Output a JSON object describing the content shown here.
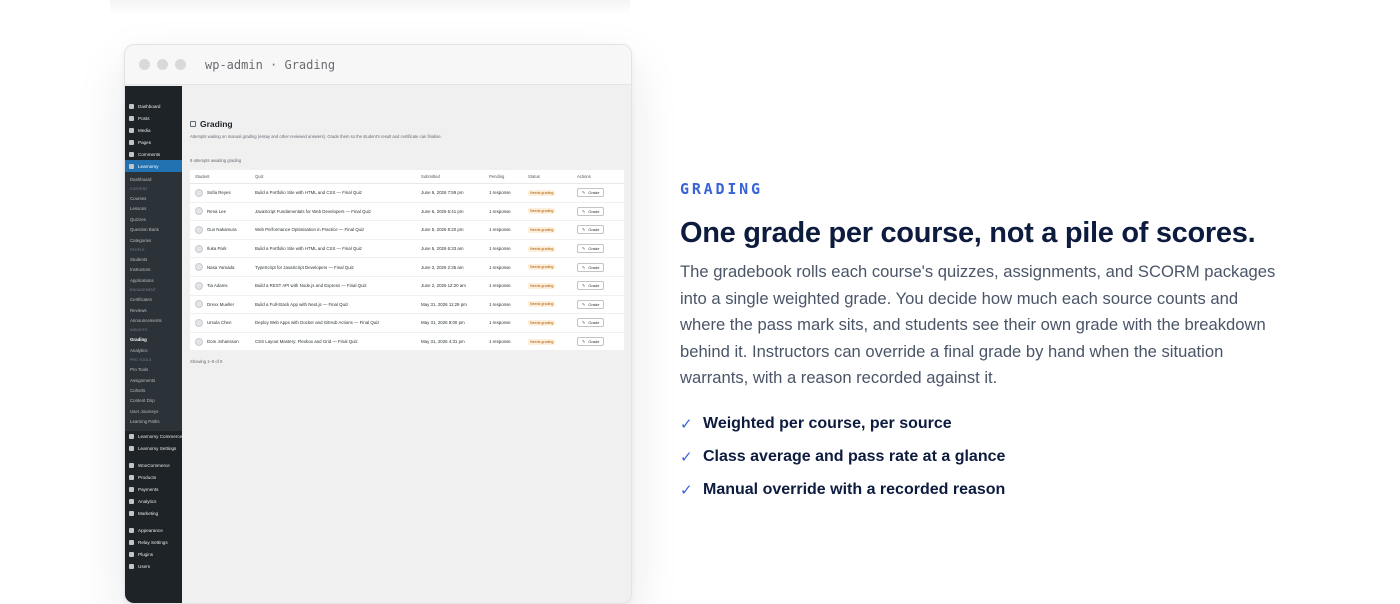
{
  "browser": {
    "url": "wp-admin · Grading"
  },
  "sidebar": {
    "top": [
      {
        "label": "Dashboard",
        "icon": "dashboard-icon"
      },
      {
        "label": "Posts",
        "icon": "pin-icon"
      },
      {
        "label": "Media",
        "icon": "media-icon"
      },
      {
        "label": "Pages",
        "icon": "page-icon"
      },
      {
        "label": "Comments",
        "icon": "comment-icon"
      },
      {
        "label": "Learnomy",
        "icon": "chart-icon"
      }
    ],
    "learnomy_sub": [
      {
        "label": "Dashboard",
        "type": "item"
      },
      {
        "label": "CONTENT",
        "type": "cap"
      },
      {
        "label": "Courses",
        "type": "item"
      },
      {
        "label": "Lessons",
        "type": "item"
      },
      {
        "label": "Quizzes",
        "type": "item"
      },
      {
        "label": "Question Bank",
        "type": "item"
      },
      {
        "label": "Categories",
        "type": "item"
      },
      {
        "label": "PEOPLE",
        "type": "cap"
      },
      {
        "label": "Students",
        "type": "item"
      },
      {
        "label": "Instructors",
        "type": "item"
      },
      {
        "label": "Applications",
        "type": "item"
      },
      {
        "label": "ENGAGEMENT",
        "type": "cap"
      },
      {
        "label": "Certificates",
        "type": "item"
      },
      {
        "label": "Reviews",
        "type": "item"
      },
      {
        "label": "Announcements",
        "type": "item"
      },
      {
        "label": "INSIGHTS",
        "type": "cap"
      },
      {
        "label": "Grading",
        "type": "current"
      },
      {
        "label": "Analytics",
        "type": "item"
      },
      {
        "label": "PRO TOOLS",
        "type": "cap"
      },
      {
        "label": "Pro Tools",
        "type": "item"
      },
      {
        "label": "Assignments",
        "type": "item"
      },
      {
        "label": "Cohorts",
        "type": "item"
      },
      {
        "label": "Content Drip",
        "type": "item"
      },
      {
        "label": "User Journeys",
        "type": "item"
      },
      {
        "label": "Learning Paths",
        "type": "item"
      }
    ],
    "bottom": [
      {
        "label": "Learnomy Commerce",
        "icon": "cart-icon"
      },
      {
        "label": "Learnomy Settings",
        "icon": "settings-icon"
      },
      {
        "label": "WooCommerce",
        "icon": "woo-icon"
      },
      {
        "label": "Products",
        "icon": "box-icon"
      },
      {
        "label": "Payments",
        "icon": "card-icon"
      },
      {
        "label": "Analytics",
        "icon": "bar-chart-icon"
      },
      {
        "label": "Marketing",
        "icon": "megaphone-icon"
      },
      {
        "label": "Appearance",
        "icon": "brush-icon"
      },
      {
        "label": "Relay Settings",
        "icon": "gear-icon"
      },
      {
        "label": "Plugins",
        "icon": "plug-icon"
      },
      {
        "label": "Users",
        "icon": "user-icon"
      }
    ]
  },
  "grading": {
    "title": "Grading",
    "description": "Attempts waiting on manual grading (essay and other reviewed answers). Grade them so the student's result and certificate can finalise.",
    "count": "9 attempts awaiting grading",
    "columns": [
      "Student",
      "Quiz",
      "Submitted",
      "Pending",
      "Status",
      "Actions"
    ],
    "rows": [
      {
        "student": "Sofia Reyes",
        "quiz": "Build a Portfolio Site with HTML and CSS — Final Quiz",
        "submitted": "June 9, 2026 7:59 pm",
        "pending": "1 response",
        "status": "Needs grading",
        "action": "Grade"
      },
      {
        "student": "Rena Lee",
        "quiz": "JavaScript Fundamentals for Web Developers — Final Quiz",
        "submitted": "June 6, 2026 6:41 pm",
        "pending": "1 response",
        "status": "Needs grading",
        "action": "Grade"
      },
      {
        "student": "Gus Nakamura",
        "quiz": "Web Performance Optimisation in Practice — Final Quiz",
        "submitted": "June 5, 2026 8:20 pm",
        "pending": "1 response",
        "status": "Needs grading",
        "action": "Grade"
      },
      {
        "student": "Iluka Park",
        "quiz": "Build a Portfolio Site with HTML and CSS — Final Quiz",
        "submitted": "June 5, 2026 6:33 am",
        "pending": "1 response",
        "status": "Needs grading",
        "action": "Grade"
      },
      {
        "student": "Nasa Yamada",
        "quiz": "TypeScript for JavaScript Developers — Final Quiz",
        "submitted": "June 3, 2026 2:35 am",
        "pending": "1 response",
        "status": "Needs grading",
        "action": "Grade"
      },
      {
        "student": "Tia Adams",
        "quiz": "Build a REST API with Node.js and Express — Final Quiz",
        "submitted": "June 2, 2026 12:20 am",
        "pending": "1 response",
        "status": "Needs grading",
        "action": "Grade"
      },
      {
        "student": "Drexx Mueller",
        "quiz": "Build a Full-Stack App with Next.js — Final Quiz",
        "submitted": "May 31, 2026 11:29 pm",
        "pending": "1 response",
        "status": "Needs grading",
        "action": "Grade"
      },
      {
        "student": "Ursula Chen",
        "quiz": "Deploy Web Apps with Docker and GitHub Actions — Final Quiz",
        "submitted": "May 31, 2026 8:00 pm",
        "pending": "1 response",
        "status": "Needs grading",
        "action": "Grade"
      },
      {
        "student": "Dom Johansson",
        "quiz": "CSS Layout Mastery: Flexbox and Grid — Final Quiz",
        "submitted": "May 31, 2026 4:31 pm",
        "pending": "1 response",
        "status": "Needs grading",
        "action": "Grade"
      }
    ],
    "showing": "Showing 1–9 of 9"
  },
  "feature": {
    "eyebrow": "GRADING",
    "headline": "One grade per course, not a pile of scores.",
    "paragraph": "The gradebook rolls each course's quizzes, assignments, and SCORM packages into a single weighted grade. You decide how much each source counts and where the pass mark sits, and students see their own grade with the breakdown behind it. Instructors can override a final grade by hand when the situation warrants, with a reason recorded against it.",
    "bullets": [
      "Weighted per course, per source",
      "Class average and pass rate at a glance",
      "Manual override with a recorded reason"
    ]
  },
  "colors": {
    "accent": "#3a63d9",
    "heading": "#0d1b3e",
    "body": "#4a5568",
    "wp_sidebar": "#1d2327",
    "wp_active": "#2271b1",
    "badge": "#b35900"
  }
}
